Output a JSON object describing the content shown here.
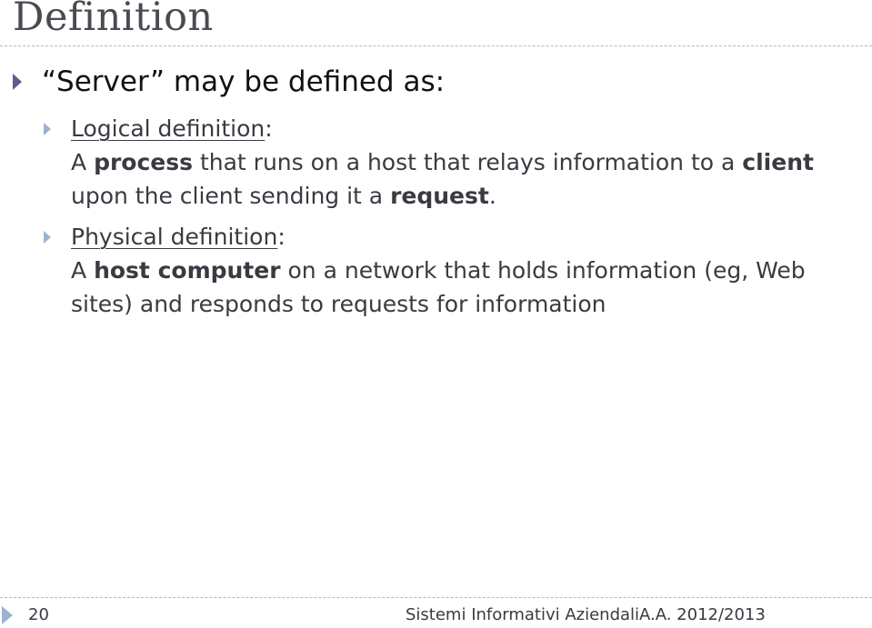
{
  "slide": {
    "title": "Definition",
    "bullet": "“Server” may be defined as:",
    "logical": {
      "heading": "Logical definition",
      "colon": ":",
      "line1_a": "A ",
      "line1_b": "process",
      "line1_c": " that runs on a host that relays  information to a ",
      "line1_d": "client",
      "line2_a": "upon the client  sending it a ",
      "line2_b": "request",
      "line2_c": "."
    },
    "physical": {
      "heading": "Physical definition",
      "colon": ":",
      "line1_a": "A ",
      "line1_b": "host computer",
      "line1_c": " on a network that holds  information (eg, Web",
      "line2": "sites) and responds  to requests for information"
    }
  },
  "footer": {
    "page_number": "20",
    "course": "Sistemi Informativi Aziendali",
    "year": "A.A. 2012/2013"
  },
  "colors": {
    "bullet_primary": "#5a5f8f",
    "bullet_secondary": "#9bb3cd"
  }
}
